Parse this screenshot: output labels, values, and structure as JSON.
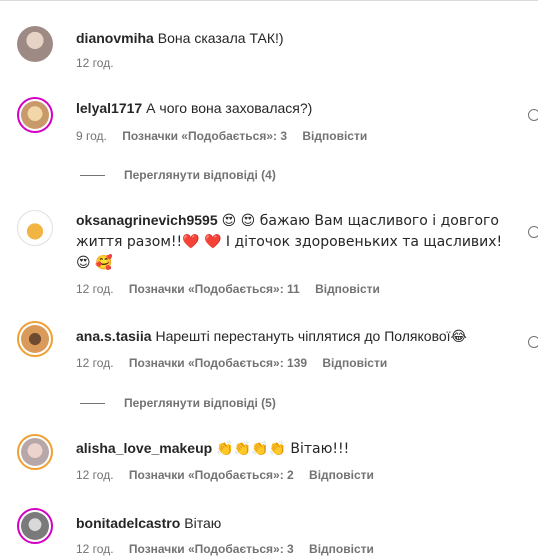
{
  "comments": [
    {
      "username": "dianovmiha",
      "text": "Вона сказала ТАК!)",
      "time": "12 год.",
      "likes": "",
      "reply": ""
    },
    {
      "username": "lelyal1717",
      "text": "А чого вона заховалася?)",
      "time": "9 год.",
      "likes": "Позначки «Подобається»: 3",
      "reply": "Відповісти",
      "view_replies": "Переглянути відповіді (4)"
    },
    {
      "username": "oksanagrinevich9595",
      "text": "😍 😍 бажаю Вам щасливого і довгого життя разом!!❤️ ❤️  І діточок здоровеньких та щасливих! 😍 🥰",
      "time": "12 год.",
      "likes": "Позначки «Подобається»: 11",
      "reply": "Відповісти"
    },
    {
      "username": "ana.s.tasiia",
      "text": "Нарешті перестануть чіплятися до Полякової😂",
      "time": "12 год.",
      "likes": "Позначки «Подобається»: 139",
      "reply": "Відповісти",
      "view_replies": "Переглянути відповіді (5)"
    },
    {
      "username": "alisha_love_makeup",
      "text": "👏👏👏👏 Вітаю!!!",
      "time": "12 год.",
      "likes": "Позначки «Подобається»: 2",
      "reply": "Відповісти"
    },
    {
      "username": "bonitadelcastro",
      "text": "Вітаю",
      "time": "12 год.",
      "likes": "Позначки «Подобається»: 3",
      "reply": "Відповісти"
    }
  ]
}
